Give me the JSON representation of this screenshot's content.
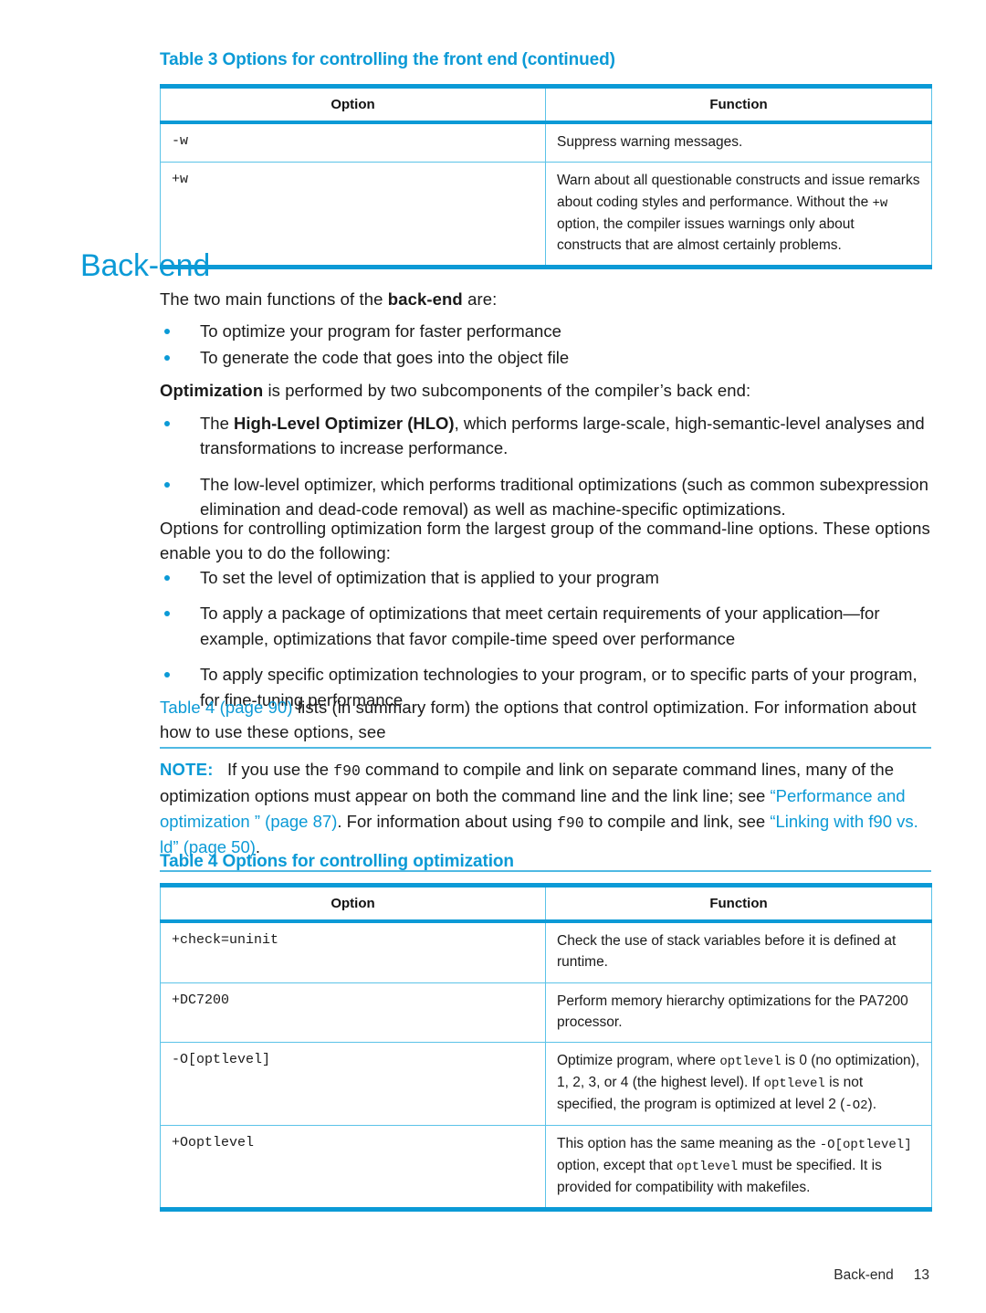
{
  "colors": {
    "brand_blue": "#0b9ad6",
    "table_rule": "#5bc3e8",
    "body_text": "#1a1a1a"
  },
  "table3": {
    "caption_main": "Table 3  Options for controlling the front end",
    "caption_continued": "(continued)",
    "headers": [
      "Option",
      "Function"
    ],
    "rows": [
      {
        "option": "-w",
        "function": "Suppress warning messages."
      },
      {
        "option": "+w",
        "function_parts": [
          {
            "t": "Warn about all questionable constructs and issue remarks about coding styles and performance. Without the ",
            "mono": false
          },
          {
            "t": "+w",
            "mono": true
          },
          {
            "t": " option, the compiler issues warnings only about constructs that are almost certainly problems.",
            "mono": false
          }
        ]
      }
    ]
  },
  "section": {
    "heading": "Back-end",
    "intro_before": "The two main functions of the ",
    "intro_bold": "back-end",
    "intro_after": " are:",
    "intro_bullets": [
      "To optimize your program for faster performance",
      "To generate the code that goes into the object file"
    ],
    "optimization_lead_bold": "Optimization",
    "optimization_lead_rest": " is performed by two subcomponents of the compiler’s back end:",
    "optimizer_bullets": [
      {
        "before": "The ",
        "bold": "High-Level Optimizer (HLO)",
        "after": ", which performs large-scale, high-semantic-level analyses and transformations to increase performance."
      },
      {
        "before": "",
        "bold": "",
        "after": "The low-level optimizer, which performs traditional optimizations (such as common subexpression elimination and dead-code removal) as well as machine-specific optimizations."
      }
    ],
    "options_para": "Options for controlling optimization form the largest group of the command-line options. These options enable you to do the following:",
    "options_bullets": [
      "To set the level of optimization that is applied to your program",
      "To apply a package of optimizations that meet certain requirements of your application—for example, optimizations that favor compile-time speed over performance",
      "To apply specific optimization technologies to your program, or to specific parts of your program, for fine-tuning performance"
    ],
    "table4_ref_link": "Table 4 (page 90)",
    "table4_ref_rest": " lists (in summary form) the options that control optimization. For information about how to use these options, see"
  },
  "note": {
    "label": "NOTE:",
    "parts": [
      {
        "t": "If you use the ",
        "kind": "plain"
      },
      {
        "t": "f90",
        "kind": "mono"
      },
      {
        "t": " command to compile and link on separate command lines, many of the optimization options must appear on both the command line and the link line; see ",
        "kind": "plain"
      },
      {
        "t": "“Performance and optimization ” (page 87)",
        "kind": "link"
      },
      {
        "t": ". For information about using ",
        "kind": "plain"
      },
      {
        "t": "f90",
        "kind": "mono"
      },
      {
        "t": " to compile and link, see ",
        "kind": "plain"
      },
      {
        "t": "“Linking with f90 vs. ld” (page 50)",
        "kind": "link"
      },
      {
        "t": ".",
        "kind": "plain"
      }
    ]
  },
  "table4": {
    "caption_main": "Table 4 Options for controlling optimization",
    "headers": [
      "Option",
      "Function"
    ],
    "rows": [
      {
        "option": "+check=uninit",
        "function_parts": [
          {
            "t": "Check the use of stack variables before it is defined at runtime.",
            "mono": false
          }
        ]
      },
      {
        "option": "+DC7200",
        "function_parts": [
          {
            "t": "Perform memory hierarchy optimizations for the PA7200 processor.",
            "mono": false
          }
        ]
      },
      {
        "option": "-O[optlevel]",
        "function_parts": [
          {
            "t": "Optimize program, where ",
            "mono": false
          },
          {
            "t": "optlevel",
            "mono": true
          },
          {
            "t": " is 0 (no optimization), 1, 2, 3, or 4 (the highest level). If ",
            "mono": false
          },
          {
            "t": "optlevel",
            "mono": true
          },
          {
            "t": " is not specified, the program is optimized at level 2 (",
            "mono": false
          },
          {
            "t": "-O2",
            "mono": true
          },
          {
            "t": ").",
            "mono": false
          }
        ]
      },
      {
        "option": "+Ooptlevel",
        "function_parts": [
          {
            "t": "This option has the same meaning as the ",
            "mono": false
          },
          {
            "t": "-O[optlevel]",
            "mono": true
          },
          {
            "t": " option, except that ",
            "mono": false
          },
          {
            "t": "optlevel",
            "mono": true
          },
          {
            "t": " must be specified. It is provided for compatibility with makefiles.",
            "mono": false
          }
        ]
      }
    ]
  },
  "footer": {
    "section_label": "Back-end",
    "page_number": "13"
  }
}
